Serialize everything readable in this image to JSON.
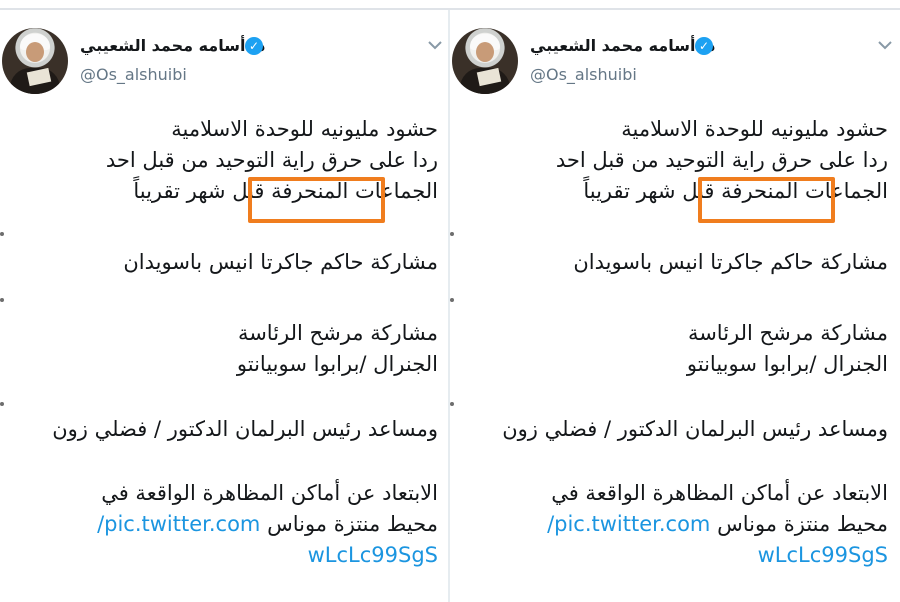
{
  "screenshots": [
    {
      "author": {
        "name": "د. أسامه محمد الشعيبي",
        "handle": "@Os_alshuibi"
      },
      "tweet": {
        "line_1": "حشود مليونيه للوحدة الاسلامية",
        "line_2": "ردا على حرق راية التوحيد من قبل احد",
        "line_3": "الجماعات المنحرفة قبل شهر تقريباً",
        "line_4": "مشاركة حاكم جاكرتا انيس باسويدان",
        "line_5": "مشاركة مرشح الرئاسة",
        "line_6": "الجنرال /برابوا سوبيانتو",
        "line_7": "ومساعد رئيس البرلمان الدكتور / فضلي زون",
        "line_8": "الابتعاد عن أماكن المظاهرة الواقعة في",
        "line_9_text": "محيط منتزة موناس",
        "line_9_link": "pic.twitter.com/",
        "line_10_link": "wLcLc99SgS"
      }
    },
    {
      "author": {
        "name": "د. أسامه محمد الشعيبي",
        "handle": "@Os_alshuibi"
      },
      "tweet": {
        "line_1": "حشود مليونيه للوحدة الاسلامية",
        "line_2": "ردا على حرق راية التوحيد من قبل احد",
        "line_3": "الجماعات المنحرفة قبل شهر تقريباً",
        "line_4": "مشاركة حاكم جاكرتا انيس باسويدان",
        "line_5": "مشاركة مرشح الرئاسة",
        "line_6": "الجنرال /برابوا سوبيانتو",
        "line_7": "ومساعد رئيس البرلمان الدكتور / فضلي زون",
        "line_8": "الابتعاد عن أماكن المظاهرة الواقعة في",
        "line_9_text": "محيط منتزة موناس",
        "line_9_link": "pic.twitter.com/",
        "line_10_link": "wLcLc99SgS"
      }
    }
  ],
  "icons": {
    "verified": "verified-badge-icon",
    "menu": "chevron-down-icon"
  },
  "colors": {
    "link": "#1b95e0",
    "verified": "#1da1f2",
    "highlight": "#f07d1e",
    "handle": "#657786"
  }
}
